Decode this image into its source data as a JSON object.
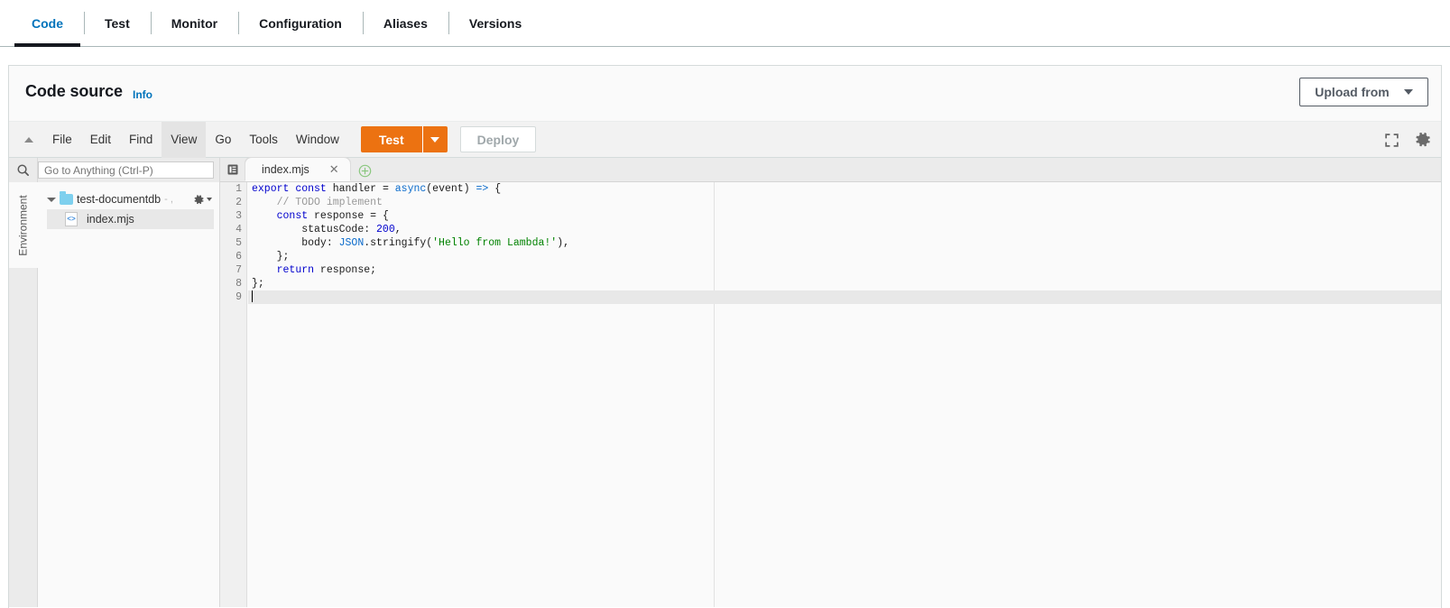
{
  "nav_tabs": [
    {
      "label": "Code",
      "active": true
    },
    {
      "label": "Test",
      "active": false
    },
    {
      "label": "Monitor",
      "active": false
    },
    {
      "label": "Configuration",
      "active": false
    },
    {
      "label": "Aliases",
      "active": false
    },
    {
      "label": "Versions",
      "active": false
    }
  ],
  "panel": {
    "title": "Code source",
    "info_link": "Info",
    "upload_button": "Upload from"
  },
  "menubar": {
    "collapse_icon": "triangle-up-icon",
    "items": [
      {
        "label": "File",
        "hover": false
      },
      {
        "label": "Edit",
        "hover": false
      },
      {
        "label": "Find",
        "hover": false
      },
      {
        "label": "View",
        "hover": true
      },
      {
        "label": "Go",
        "hover": false
      },
      {
        "label": "Tools",
        "hover": false
      },
      {
        "label": "Window",
        "hover": false
      }
    ],
    "test_button": "Test",
    "deploy_button": "Deploy",
    "fullscreen_icon": "expand-icon",
    "settings_icon": "gear-icon"
  },
  "sidebar": {
    "rail_label": "Environment",
    "search_icon": "search-icon",
    "goto_placeholder": "Go to Anything (Ctrl-P)",
    "tree": {
      "folder": {
        "name": "test-documentdb",
        "suffix": "- ,",
        "expanded": true
      },
      "files": [
        {
          "name": "index.mjs",
          "selected": true
        }
      ]
    }
  },
  "editor": {
    "tabbar_icon": "file-list-icon",
    "open_tabs": [
      {
        "label": "index.mjs",
        "close_icon": "close-icon",
        "active": true
      }
    ],
    "new_tab_icon": "plus-circle-icon",
    "active_line": 9,
    "cursor_line": 9,
    "lines": [
      {
        "n": 1,
        "tokens": [
          {
            "t": "export ",
            "c": "kw"
          },
          {
            "t": "const ",
            "c": "kw"
          },
          {
            "t": "handler ",
            "c": "plain"
          },
          {
            "t": "= ",
            "c": "plain"
          },
          {
            "t": "async",
            "c": "kw2"
          },
          {
            "t": "(event) ",
            "c": "plain"
          },
          {
            "t": "=>",
            "c": "op"
          },
          {
            "t": " {",
            "c": "plain"
          }
        ]
      },
      {
        "n": 2,
        "tokens": [
          {
            "t": "    // TODO implement",
            "c": "cmt"
          }
        ]
      },
      {
        "n": 3,
        "tokens": [
          {
            "t": "    ",
            "c": "plain"
          },
          {
            "t": "const ",
            "c": "kw"
          },
          {
            "t": "response = {",
            "c": "plain"
          }
        ]
      },
      {
        "n": 4,
        "tokens": [
          {
            "t": "        statusCode: ",
            "c": "plain"
          },
          {
            "t": "200",
            "c": "num"
          },
          {
            "t": ",",
            "c": "plain"
          }
        ]
      },
      {
        "n": 5,
        "tokens": [
          {
            "t": "        body: ",
            "c": "plain"
          },
          {
            "t": "JSON",
            "c": "cls"
          },
          {
            "t": ".stringify(",
            "c": "plain"
          },
          {
            "t": "'Hello from Lambda!'",
            "c": "str"
          },
          {
            "t": "),",
            "c": "plain"
          }
        ]
      },
      {
        "n": 6,
        "tokens": [
          {
            "t": "    };",
            "c": "plain"
          }
        ]
      },
      {
        "n": 7,
        "tokens": [
          {
            "t": "    ",
            "c": "plain"
          },
          {
            "t": "return ",
            "c": "kw"
          },
          {
            "t": "response;",
            "c": "plain"
          }
        ]
      },
      {
        "n": 8,
        "tokens": [
          {
            "t": "};",
            "c": "plain"
          }
        ]
      },
      {
        "n": 9,
        "tokens": []
      }
    ]
  },
  "colors": {
    "accent_blue": "#0073bb",
    "test_orange": "#ec7211",
    "tab_underline": "#16191f",
    "keyword": "#0000cd",
    "string": "#008200",
    "comment": "#9a9a9a",
    "folder": "#7ed0ee"
  }
}
